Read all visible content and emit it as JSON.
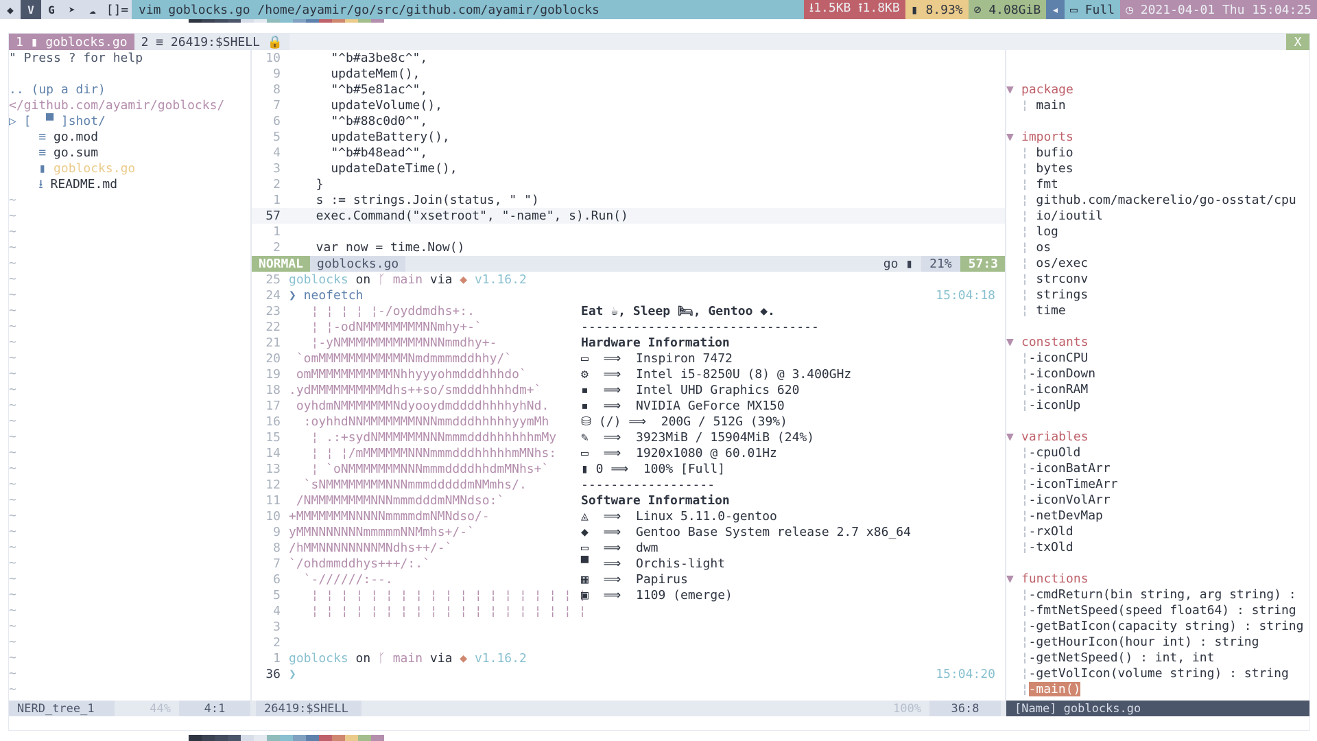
{
  "topbar": {
    "layout": "[]=",
    "window_title": "vim goblocks.go /home/ayamir/go/src/github.com/ayamir/goblocks",
    "net_down": "⭳1.5KB",
    "net_up": "⭱1.8KB",
    "cpu": "8.93%",
    "mem": "4.08GiB",
    "volume_icon": "◂",
    "battery": "Full",
    "datetime": "2021-04-01 Thu 15:04:25",
    "colors": {
      "net": "#bf616a",
      "cpu": "#ebcb8b",
      "mem": "#a3be8c",
      "vol": "#5e81ac",
      "bat": "#88c0d0",
      "date": "#b48ead",
      "title": "#88c0d0"
    }
  },
  "tabline": {
    "tab1": "1 ▮ goblocks.go",
    "tab2": "2 ≡ 26419:$SHELL 🔒",
    "close": "X"
  },
  "nerdtree": {
    "help": "\" Press ? for help",
    "up": ".. (up a dir)",
    "root": "</github.com/ayamir/goblocks/",
    "items": [
      {
        "prefix": "▷ [  ▀ ",
        "name": "]shot/",
        "cls": "blue"
      },
      {
        "prefix": "    ≡ ",
        "name": "go.mod",
        "cls": "dark"
      },
      {
        "prefix": "    ≡ ",
        "name": "go.sum",
        "cls": "dark"
      },
      {
        "prefix": "    ▮ ",
        "name": "goblocks.go",
        "cls": "yellow"
      },
      {
        "prefix": "    ⭳ ",
        "name": "README.md",
        "cls": "dark"
      }
    ]
  },
  "code": {
    "lines": [
      {
        "nr": "10",
        "text": "    \"^b#a3be8c^\","
      },
      {
        "nr": "9",
        "text": "    updateMem(),"
      },
      {
        "nr": "8",
        "text": "    \"^b#5e81ac^\","
      },
      {
        "nr": "7",
        "text": "    updateVolume(),"
      },
      {
        "nr": "6",
        "text": "    \"^b#88c0d0^\","
      },
      {
        "nr": "5",
        "text": "    updateBattery(),"
      },
      {
        "nr": "4",
        "text": "    \"^b#b48ead^\","
      },
      {
        "nr": "3",
        "text": "    updateDateTime(),"
      },
      {
        "nr": "2",
        "text": "  }"
      },
      {
        "nr": "1",
        "text": "  s := strings.Join(status, \" \")"
      },
      {
        "nr": "57",
        "text": "  exec.Command(\"xsetroot\", \"-name\", s).Run()",
        "current": true
      },
      {
        "nr": "1",
        "text": ""
      },
      {
        "nr": "2",
        "text": "  var now = time.Now()"
      }
    ]
  },
  "vimstatus": {
    "mode": "NORMAL",
    "file": "goblocks.go",
    "filetype": "go ▮",
    "percent": "21%",
    "position": "57:3"
  },
  "shell": {
    "prompt1": {
      "nr": "25",
      "dir": "goblocks",
      "on": "on",
      "branch": "ᚴ main",
      "via": "via",
      "ver": "v1.16.2"
    },
    "cmd": {
      "nr": "24",
      "text": "❯ neofetch",
      "time": "15:04:18"
    },
    "logo": [
      {
        "nr": "23",
        "text": "   ¦ ¦ ¦ ¦ ¦-/oyddmdhs+:."
      },
      {
        "nr": "22",
        "text": "   ¦ ¦-odNMMMMMMMMNNmhy+-`"
      },
      {
        "nr": "21",
        "text": "   ¦-yNMMMMMMMMMMMNNNmmdhy+-"
      },
      {
        "nr": "20",
        "text": " `omMMMMMMMMMMMMNmdmmmmddhhy/`"
      },
      {
        "nr": "19",
        "text": " omMMMMMMMMMMMNhhyyyohmdddhhhdo`"
      },
      {
        "nr": "18",
        "text": ".ydMMMMMMMMMMdhs++so/smdddhhhhdm+`"
      },
      {
        "nr": "17",
        "text": " oyhdmNMMMMMMMNdyooydmddddhhhhyhNd."
      },
      {
        "nr": "16",
        "text": "  :oyhhdNNMMMMMMMNNNmmdddhhhhhyymMh"
      },
      {
        "nr": "15",
        "text": "   ¦ .:+sydNMMMMMMNNNmmmdddhhhhhhmMy"
      },
      {
        "nr": "14",
        "text": "   ¦ ¦ ¦/mMMMMMMNNNmmmdddhhhhhmMNhs:"
      },
      {
        "nr": "13",
        "text": "   ¦ `oNMMMMMMMNNNmmmddddhhdmMNhs+`"
      },
      {
        "nr": "12",
        "text": "  `sNMMMMMMMMNNNmmmdddddmNMmhs/."
      },
      {
        "nr": "11",
        "text": " /NMMMMMMMMNNNmmmdddmNMNdso:`"
      },
      {
        "nr": "10",
        "text": "+MMMMMMMNNNNNmmmmdmNMNdso/-"
      },
      {
        "nr": "9",
        "text": "yMMNNNNNNNmmmmmNNMmhs+/-`"
      },
      {
        "nr": "8",
        "text": "/hMMNNNNNNNNMNdhs++/-`"
      },
      {
        "nr": "7",
        "text": "`/ohdmmddhys+++/:.`"
      },
      {
        "nr": "6",
        "text": "  `-//////:--."
      },
      {
        "nr": "5",
        "text": "   ¦ ¦ ¦ ¦ ¦ ¦ ¦ ¦ ¦ ¦ ¦ ¦ ¦ ¦ ¦ ¦ ¦ ¦ ¦"
      },
      {
        "nr": "4",
        "text": "   ¦ ¦ ¦ ¦ ¦ ¦ ¦ ¦ ¦ ¦ ¦ ¦ ¦ ¦ ¦ ¦ ¦ ¦ ¦"
      },
      {
        "nr": "3",
        "text": ""
      },
      {
        "nr": "2",
        "text": ""
      }
    ],
    "info": [
      {
        "text": "Eat ☕, Sleep 🛏, Gentoo ◆.",
        "cls": "dark",
        "bold": true
      },
      {
        "text": "--------------------------------",
        "cls": "dark"
      },
      {
        "text": "Hardware Information",
        "cls": "dark",
        "bold": true
      },
      {
        "text": "▭  ⟹  Inspiron 7472",
        "cls": "dark"
      },
      {
        "text": "⚙  ⟹  Intel i5-8250U (8) @ 3.400GHz",
        "cls": "dark"
      },
      {
        "text": "▪  ⟹  Intel UHD Graphics 620",
        "cls": "dark"
      },
      {
        "text": "▪  ⟹  NVIDIA GeForce MX150",
        "cls": "dark"
      },
      {
        "text": "⛁ (/) ⟹  200G / 512G (39%)",
        "cls": "dark"
      },
      {
        "text": "✎  ⟹  3923MiB / 15904MiB (24%)",
        "cls": "dark"
      },
      {
        "text": "▭  ⟹  1920x1080 @ 60.01Hz",
        "cls": "dark"
      },
      {
        "text": "▮ 0 ⟹  100% [Full]",
        "cls": "dark"
      },
      {
        "text": "------------------",
        "cls": "dark"
      },
      {
        "text": "Software Information",
        "cls": "dark",
        "bold": true
      },
      {
        "text": "◬  ⟹  Linux 5.11.0-gentoo",
        "cls": "dark"
      },
      {
        "text": "◆  ⟹  Gentoo Base System release 2.7 x86_64",
        "cls": "dark"
      },
      {
        "text": "▭  ⟹  dwm",
        "cls": "dark"
      },
      {
        "text": "▀  ⟹  Orchis-light",
        "cls": "dark"
      },
      {
        "text": "▦  ⟹  Papirus",
        "cls": "dark"
      },
      {
        "text": "▣  ⟹  1109 (emerge)",
        "cls": "dark"
      }
    ],
    "prompt2": {
      "nr": "1",
      "dir": "goblocks",
      "on": "on",
      "branch": "ᚴ main",
      "via": "via",
      "ver": "v1.16.2"
    },
    "last": {
      "nr": "36",
      "text": "❯",
      "time": "15:04:20"
    }
  },
  "tagbar": {
    "sections": [
      {
        "name": "package",
        "items": [
          "main"
        ],
        "nested": true
      },
      {
        "name": "imports",
        "items": [
          "bufio",
          "bytes",
          "fmt",
          "github.com/mackerelio/go-osstat/cpu",
          "io/ioutil",
          "log",
          "os",
          "os/exec",
          "strconv",
          "strings",
          "time"
        ],
        "nested": true
      },
      {
        "name": "constants",
        "items": [
          "-iconCPU",
          "-iconDown",
          "-iconRAM",
          "-iconUp"
        ]
      },
      {
        "name": "variables",
        "items": [
          "-cpuOld",
          "-iconBatArr",
          "-iconTimeArr",
          "-iconVolArr",
          "-netDevMap",
          "-rxOld",
          "-txOld"
        ]
      },
      {
        "name": "functions",
        "items": [
          "-cmdReturn(bin string, arg string) :",
          "-fmtNetSpeed(speed float64) : string",
          "-getBatIcon(capacity string) : string",
          "-getHourIcon(hour int) : string",
          "-getNetSpeed() : int, int",
          "-getVolIcon(volume string) : string",
          "-main()"
        ]
      }
    ]
  },
  "bottombar": {
    "nerd": "NERD_tree_1",
    "nerd_pct": "44%",
    "nerd_pos": "4:1",
    "shell": "26419:$SHELL",
    "shell_pct": "100%",
    "shell_pos": "36:8",
    "name": "[Name] goblocks.go"
  },
  "tilde": "~"
}
